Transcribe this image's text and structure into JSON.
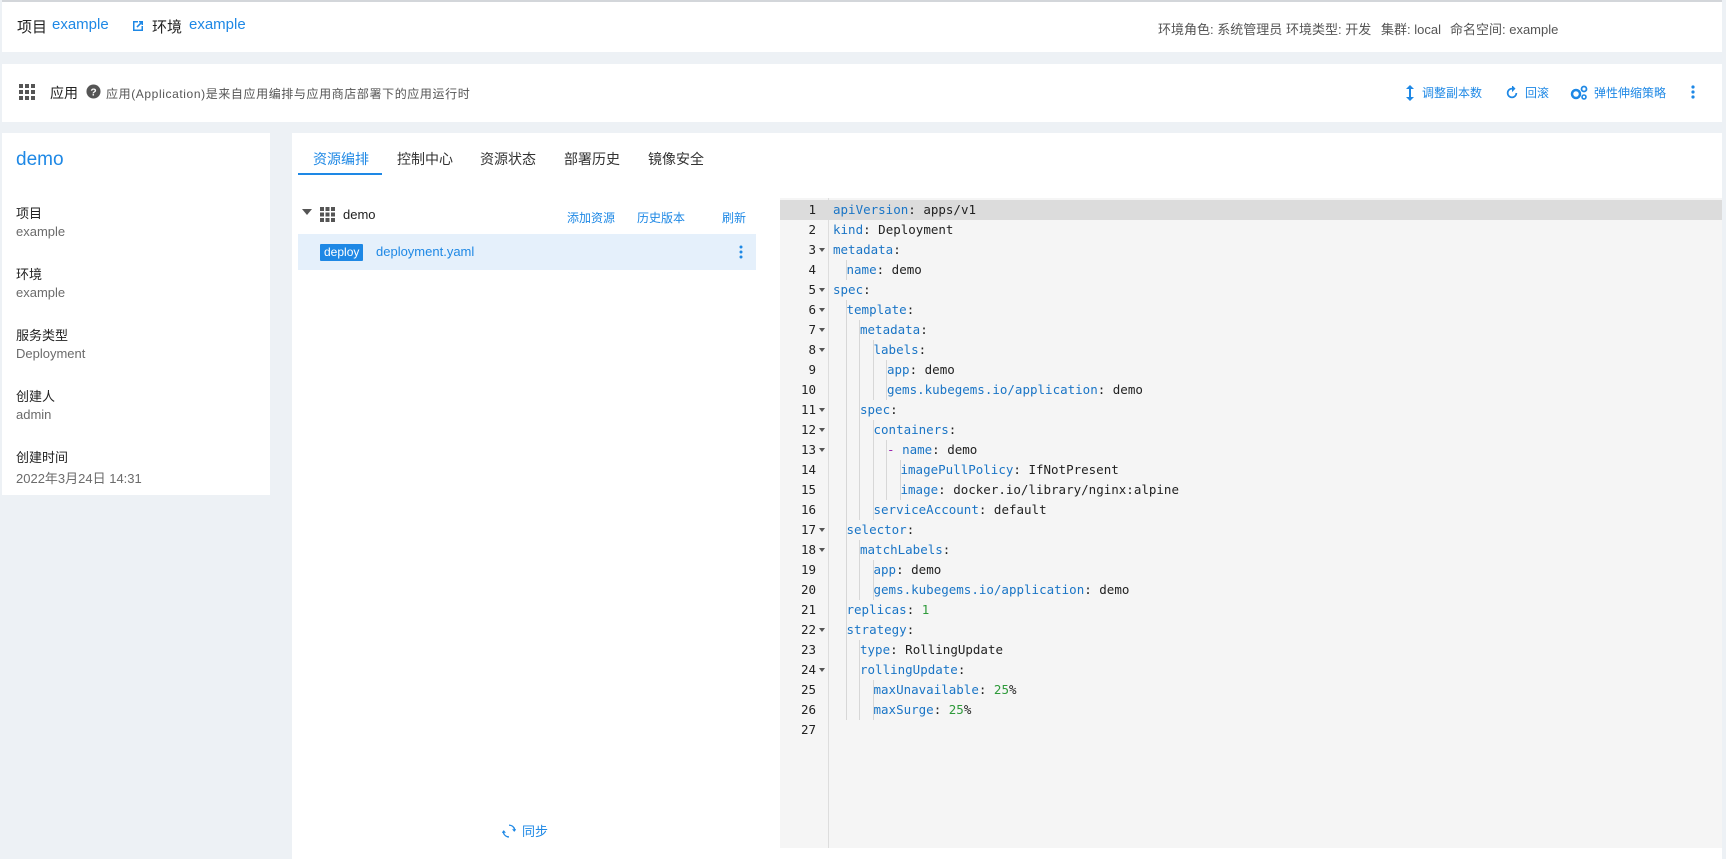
{
  "topbar": {
    "project_label": "项目",
    "project_value": "example",
    "env_label": "环境",
    "env_value": "example",
    "env_role": "环境角色: 系统管理员",
    "env_type": "环境类型: 开发",
    "cluster": "集群: local",
    "namespace": "命名空间: example"
  },
  "appbar": {
    "title": "应用",
    "description": "应用(Application)是来自应用编排与应用商店部署下的应用运行时",
    "actions": {
      "scale": "调整副本数",
      "rollback": "回滚",
      "hpa": "弹性伸缩策略"
    }
  },
  "info": {
    "name": "demo",
    "fields": [
      {
        "key": "项目",
        "value": "example"
      },
      {
        "key": "环境",
        "value": "example"
      },
      {
        "key": "服务类型",
        "value": "Deployment"
      },
      {
        "key": "创建人",
        "value": "admin"
      },
      {
        "key": "创建时间",
        "value": "2022年3月24日 14:31"
      }
    ]
  },
  "tabs": [
    "资源编排",
    "控制中心",
    "资源状态",
    "部署历史",
    "镜像安全"
  ],
  "tree": {
    "root_name": "demo",
    "actions": {
      "add": "添加资源",
      "history": "历史版本",
      "refresh": "刷新"
    },
    "file": {
      "badge": "deploy",
      "name": "deployment.yaml"
    },
    "sync": "同步"
  },
  "colors": {
    "accent": "#1e88e5",
    "key": "#1a75c6",
    "number": "#2e9a3a"
  },
  "editor": {
    "current_line": 1,
    "lines": [
      {
        "n": 1,
        "indent": 0,
        "fold": false,
        "key": "apiVersion",
        "sep": ": ",
        "val": "apps/v1",
        "vtype": "str"
      },
      {
        "n": 2,
        "indent": 0,
        "fold": false,
        "key": "kind",
        "sep": ": ",
        "val": "Deployment",
        "vtype": "str"
      },
      {
        "n": 3,
        "indent": 0,
        "fold": true,
        "key": "metadata",
        "sep": ":",
        "val": "",
        "vtype": "str"
      },
      {
        "n": 4,
        "indent": 1,
        "fold": false,
        "key": "name",
        "sep": ": ",
        "val": "demo",
        "vtype": "str"
      },
      {
        "n": 5,
        "indent": 0,
        "fold": true,
        "key": "spec",
        "sep": ":",
        "val": "",
        "vtype": "str"
      },
      {
        "n": 6,
        "indent": 1,
        "fold": true,
        "key": "template",
        "sep": ":",
        "val": "",
        "vtype": "str"
      },
      {
        "n": 7,
        "indent": 2,
        "fold": true,
        "key": "metadata",
        "sep": ":",
        "val": "",
        "vtype": "str"
      },
      {
        "n": 8,
        "indent": 3,
        "fold": true,
        "key": "labels",
        "sep": ":",
        "val": "",
        "vtype": "str"
      },
      {
        "n": 9,
        "indent": 4,
        "fold": false,
        "key": "app",
        "sep": ": ",
        "val": "demo",
        "vtype": "str"
      },
      {
        "n": 10,
        "indent": 4,
        "fold": false,
        "key": "gems.kubegems.io/application",
        "sep": ": ",
        "val": "demo",
        "vtype": "str"
      },
      {
        "n": 11,
        "indent": 2,
        "fold": true,
        "key": "spec",
        "sep": ":",
        "val": "",
        "vtype": "str"
      },
      {
        "n": 12,
        "indent": 3,
        "fold": true,
        "key": "containers",
        "sep": ":",
        "val": "",
        "vtype": "str"
      },
      {
        "n": 13,
        "indent": 4,
        "fold": true,
        "dash": "- ",
        "key": "name",
        "sep": ": ",
        "val": "demo",
        "vtype": "str"
      },
      {
        "n": 14,
        "indent": 5,
        "fold": false,
        "key": "imagePullPolicy",
        "sep": ": ",
        "val": "IfNotPresent",
        "vtype": "str"
      },
      {
        "n": 15,
        "indent": 5,
        "fold": false,
        "key": "image",
        "sep": ": ",
        "val": "docker.io/library/nginx:alpine",
        "vtype": "str"
      },
      {
        "n": 16,
        "indent": 3,
        "fold": false,
        "key": "serviceAccount",
        "sep": ": ",
        "val": "default",
        "vtype": "str"
      },
      {
        "n": 17,
        "indent": 1,
        "fold": true,
        "key": "selector",
        "sep": ":",
        "val": "",
        "vtype": "str"
      },
      {
        "n": 18,
        "indent": 2,
        "fold": true,
        "key": "matchLabels",
        "sep": ":",
        "val": "",
        "vtype": "str"
      },
      {
        "n": 19,
        "indent": 3,
        "fold": false,
        "key": "app",
        "sep": ": ",
        "val": "demo",
        "vtype": "str"
      },
      {
        "n": 20,
        "indent": 3,
        "fold": false,
        "key": "gems.kubegems.io/application",
        "sep": ": ",
        "val": "demo",
        "vtype": "str"
      },
      {
        "n": 21,
        "indent": 1,
        "fold": false,
        "key": "replicas",
        "sep": ": ",
        "val": "1",
        "vtype": "num"
      },
      {
        "n": 22,
        "indent": 1,
        "fold": true,
        "key": "strategy",
        "sep": ":",
        "val": "",
        "vtype": "str"
      },
      {
        "n": 23,
        "indent": 2,
        "fold": false,
        "key": "type",
        "sep": ": ",
        "val": "RollingUpdate",
        "vtype": "str"
      },
      {
        "n": 24,
        "indent": 2,
        "fold": true,
        "key": "rollingUpdate",
        "sep": ":",
        "val": "",
        "vtype": "str"
      },
      {
        "n": 25,
        "indent": 3,
        "fold": false,
        "key": "maxUnavailable",
        "sep": ": ",
        "val": "25",
        "suffix": "%",
        "vtype": "num"
      },
      {
        "n": 26,
        "indent": 3,
        "fold": false,
        "key": "maxSurge",
        "sep": ": ",
        "val": "25",
        "suffix": "%",
        "vtype": "num"
      },
      {
        "n": 27,
        "indent": 0,
        "fold": false,
        "key": "",
        "sep": "",
        "val": "",
        "vtype": "str"
      }
    ]
  }
}
